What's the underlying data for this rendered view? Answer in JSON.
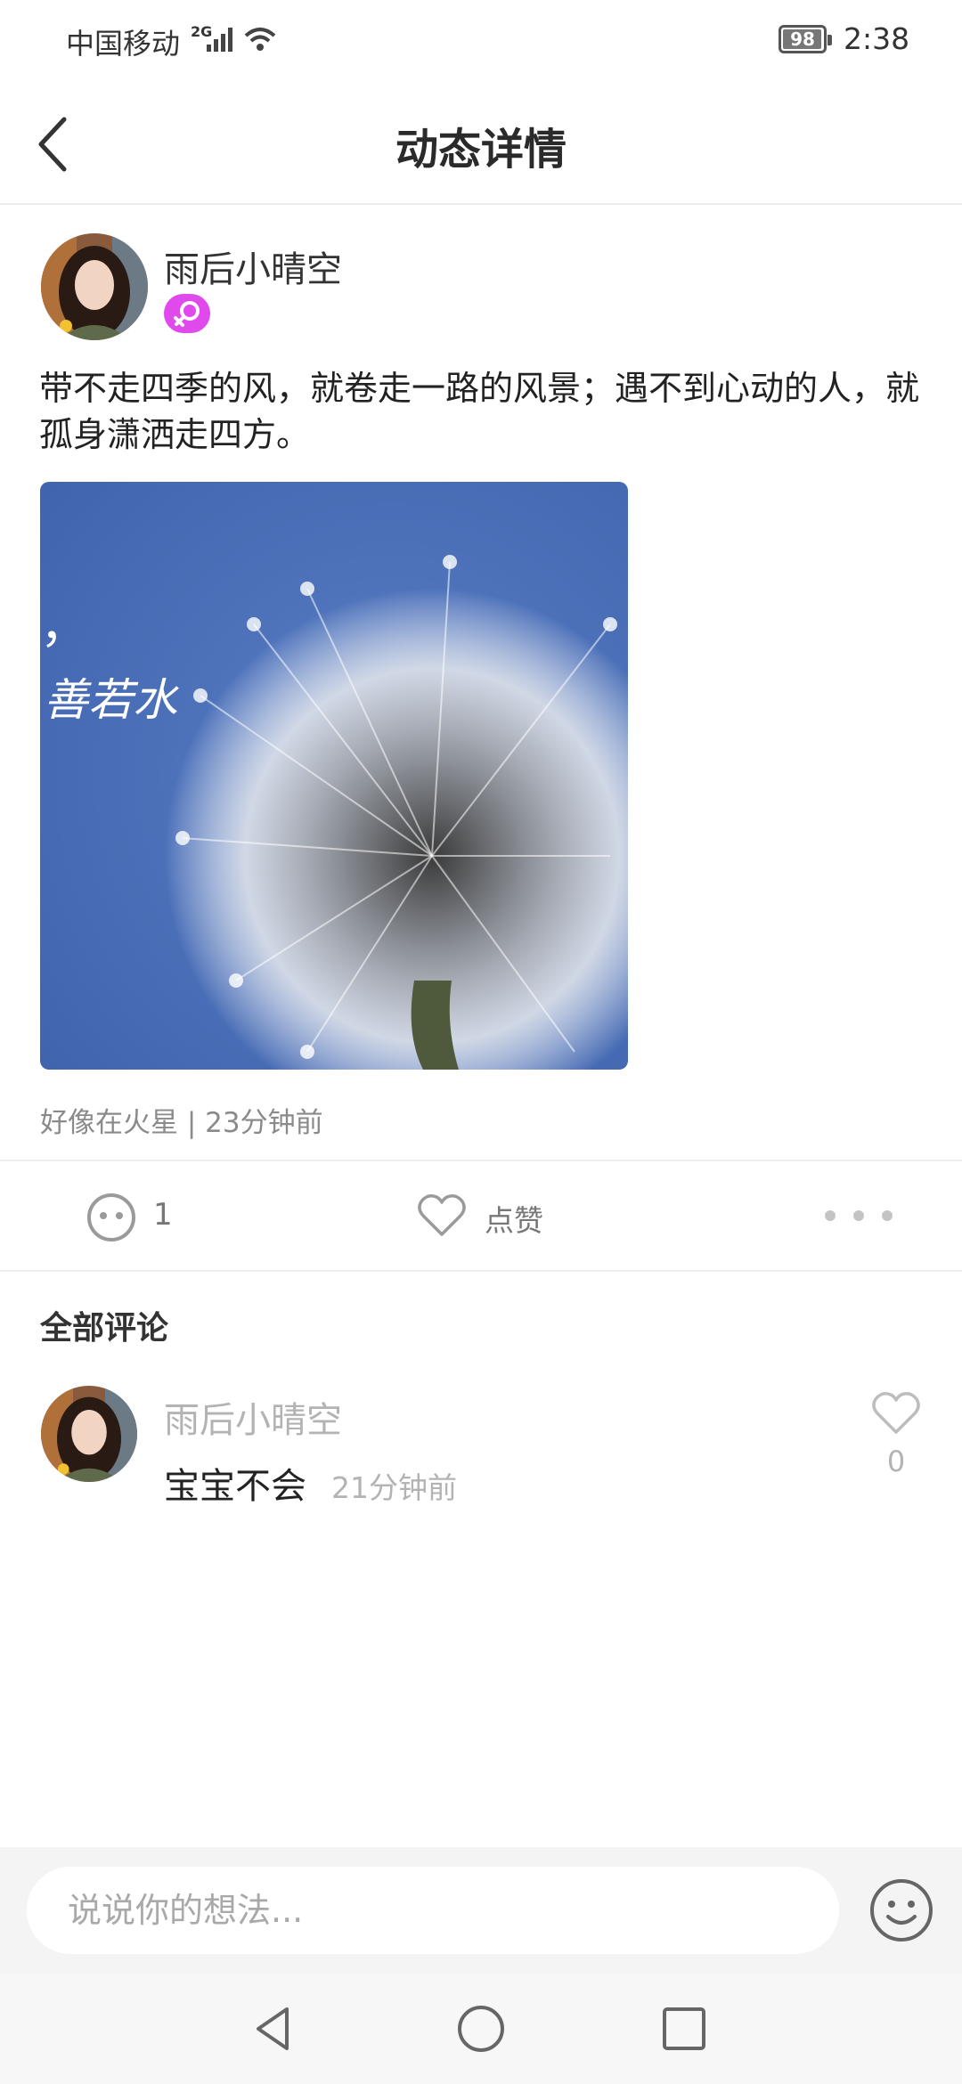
{
  "status_bar": {
    "carrier": "中国移动",
    "network": "2G",
    "battery": "98",
    "battery_fraction": 0.98,
    "time": "2:38"
  },
  "header": {
    "title": "动态详情",
    "back_icon": "chevron-left-icon"
  },
  "post": {
    "username": "雨后小晴空",
    "gender_badge_icon": "female-symbol-icon",
    "gender_badge_color": "#e04aed",
    "text": "带不走四季的风，就卷走一路的风景；遇不到心动的人，就孤身潇洒走四方。",
    "image_caption": "善若水",
    "image_caption_top": "，",
    "meta": "好像在火星 | 23分钟前"
  },
  "actions": {
    "comment_icon": "comment-bubble-icon",
    "comment_count": "1",
    "like_icon": "heart-outline-icon",
    "like_label": "点赞",
    "more_icon": "more-dots-icon"
  },
  "comments": {
    "title": "全部评论",
    "items": [
      {
        "username": "雨后小晴空",
        "text": "宝宝不会",
        "time": "21分钟前",
        "like_count": "0",
        "like_icon": "heart-outline-icon"
      }
    ]
  },
  "input_bar": {
    "placeholder": "说说你的想法...",
    "emoji_icon": "smiley-icon"
  },
  "nav_bar": {
    "back_icon": "triangle-back-icon",
    "home_icon": "circle-home-icon",
    "recent_icon": "square-recent-icon"
  }
}
